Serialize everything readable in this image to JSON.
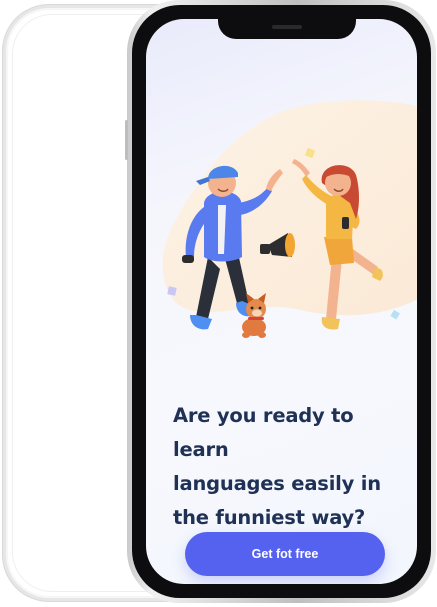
{
  "onboarding": {
    "headline_line1": "Are you ready to learn",
    "headline_line2": "languages easily in",
    "headline_line3": "the funniest way?",
    "cta_label": "Get fot free"
  },
  "colors": {
    "primary": "#5562ef",
    "headline": "#1f3256",
    "screen_background": "#f5f6fc",
    "illustration_blob": "#fdf1e2"
  },
  "icons": {
    "illustration": "two-friends-high-five-illustration",
    "megaphone": "megaphone-icon",
    "dog": "dog-icon"
  }
}
